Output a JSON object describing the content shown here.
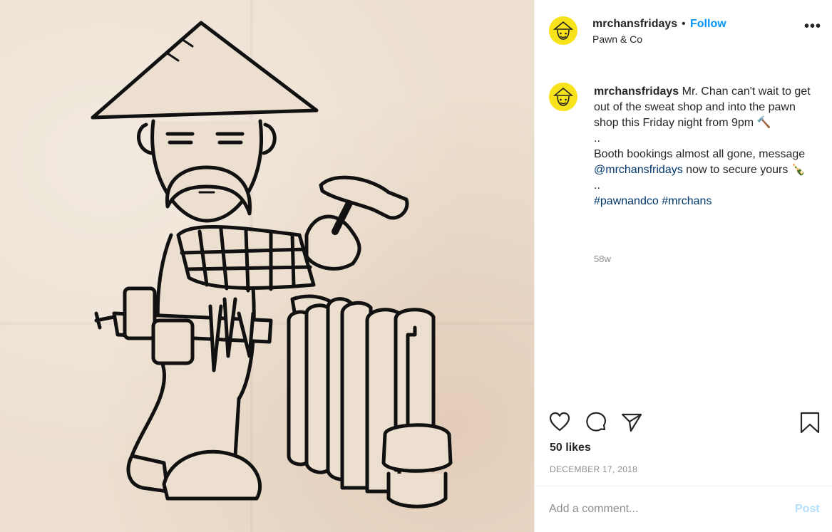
{
  "post": {
    "image_alt": "Cartoon of Mr. Chan with hammer and tool belt next to a radiator"
  },
  "header": {
    "username": "mrchansfridays",
    "separator": "•",
    "follow_label": "Follow",
    "location": "Pawn & Co",
    "more_icon": "more-horizontal-icon"
  },
  "caption": {
    "username": "mrchansfridays",
    "line1": " Mr. Chan can't wait to get out of the sweat shop and into the pawn shop this Friday night from 9pm ",
    "emoji1": "🔨",
    "sep1": "..",
    "line2_pre": "Booth bookings almost all gone, message ",
    "mention": "@mrchansfridays",
    "line2_post": " now to secure yours ",
    "emoji2": "🍾",
    "sep2": "..",
    "hashtag1": "#pawnandco",
    "hashtag2": "#mrchans",
    "age": "58w"
  },
  "actions": {
    "like_icon": "heart-icon",
    "comment_icon": "comment-icon",
    "share_icon": "share-icon",
    "save_icon": "bookmark-icon"
  },
  "likes": "50 likes",
  "date": "DECEMBER 17, 2018",
  "comment": {
    "placeholder": "Add a comment...",
    "post_label": "Post"
  },
  "colors": {
    "accent": "#0095f6",
    "avatar_bg": "#f7e21b",
    "link": "#00376b",
    "post_disabled": "#b2dffc"
  }
}
